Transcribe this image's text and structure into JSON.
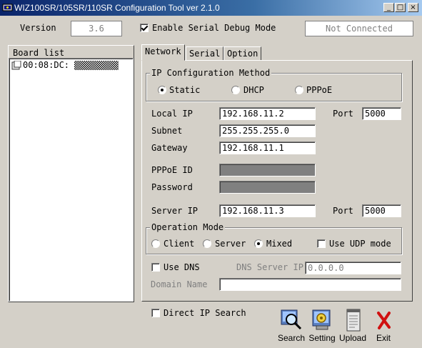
{
  "window": {
    "title": "WIZ100SR/105SR/110SR Configuration Tool ver 2.1.0",
    "min_label": "_",
    "max_label": "□",
    "close_label": "×"
  },
  "header": {
    "version_label": "Version",
    "version_value": "3.6",
    "debug_label": "Enable Serial Debug Mode",
    "debug_checked": true,
    "status": "Not Connected"
  },
  "board_list": {
    "title": "Board list",
    "items": [
      "00:08:DC:"
    ]
  },
  "tabs": [
    "Network",
    "Serial",
    "Option"
  ],
  "network": {
    "ip_method": {
      "title": "IP Configuration Method",
      "options": [
        "Static",
        "DHCP",
        "PPPoE"
      ],
      "selected": "Static"
    },
    "local_ip_label": "Local IP",
    "local_ip": "192.168.11.2",
    "port_label": "Port",
    "local_port": "5000",
    "subnet_label": "Subnet",
    "subnet": "255.255.255.0",
    "gateway_label": "Gateway",
    "gateway": "192.168.11.1",
    "pppoe_id_label": "PPPoE ID",
    "password_label": "Password",
    "server_ip_label": "Server IP",
    "server_ip": "192.168.11.3",
    "server_port": "5000",
    "op_mode": {
      "title": "Operation Mode",
      "options": [
        "Client",
        "Server",
        "Mixed"
      ],
      "selected": "Mixed",
      "udp_label": "Use UDP mode"
    },
    "use_dns_label": "Use DNS",
    "dns_server_label": "DNS Server IP",
    "dns_server_ip": "0.0.0.0",
    "domain_name_label": "Domain Name",
    "domain_name": ""
  },
  "bottom": {
    "direct_ip_label": "Direct IP Search",
    "buttons": [
      "Search",
      "Setting",
      "Upload",
      "Exit"
    ]
  }
}
